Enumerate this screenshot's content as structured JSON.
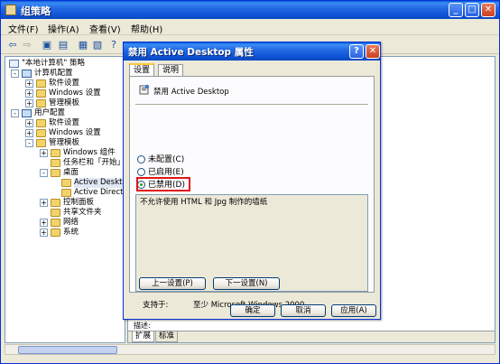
{
  "main_window": {
    "title": "组策略",
    "menu": [
      "文件(F)",
      "操作(A)",
      "查看(V)",
      "帮助(H)"
    ],
    "toolbar_icons": [
      "back-arrow-icon",
      "forward-arrow-icon",
      "up-folder-icon",
      "show-tree-icon",
      "properties-icon",
      "export-icon",
      "help-icon"
    ]
  },
  "tree": {
    "items": [
      {
        "label": "\"本地计算机\" 策略",
        "icon": "policy-icon"
      },
      {
        "label": "计算机配置",
        "icon": "computer-icon",
        "toggle": "-"
      },
      {
        "label": "软件设置",
        "icon": "folder-icon",
        "toggle": "+"
      },
      {
        "label": "Windows 设置",
        "icon": "folder-icon",
        "toggle": "+"
      },
      {
        "label": "管理模板",
        "icon": "folder-icon",
        "toggle": "+"
      },
      {
        "label": "用户配置",
        "icon": "user-icon",
        "toggle": "-"
      },
      {
        "label": "软件设置",
        "icon": "folder-icon",
        "toggle": "+"
      },
      {
        "label": "Windows 设置",
        "icon": "folder-icon",
        "toggle": "+"
      },
      {
        "label": "管理模板",
        "icon": "folder-icon",
        "toggle": "-"
      },
      {
        "label": "Windows 组件",
        "icon": "folder-icon",
        "toggle": "+"
      },
      {
        "label": "任务栏和「开始」菜",
        "icon": "folder-icon",
        "toggle": ""
      },
      {
        "label": "桌面",
        "icon": "folder-icon",
        "toggle": "-"
      },
      {
        "label": "Active Desktop",
        "icon": "folder-icon",
        "toggle": ""
      },
      {
        "label": "Active Directo",
        "icon": "folder-icon",
        "toggle": ""
      },
      {
        "label": "控制面板",
        "icon": "folder-icon",
        "toggle": "+"
      },
      {
        "label": "共享文件夹",
        "icon": "folder-icon",
        "toggle": ""
      },
      {
        "label": "网络",
        "icon": "folder-icon",
        "toggle": "+"
      },
      {
        "label": "系统",
        "icon": "folder-icon",
        "toggle": "+"
      }
    ]
  },
  "right_pane": {
    "fragment_text": "描述:",
    "tabs": [
      "扩展",
      "标准"
    ]
  },
  "dialog": {
    "title": "禁用 Active Desktop 属性",
    "tabs": [
      "设置",
      "说明"
    ],
    "setting_name": "禁用 Active Desktop",
    "radios": [
      {
        "label": "未配置(C)",
        "checked": false
      },
      {
        "label": "已启用(E)",
        "checked": false
      },
      {
        "label": "已禁用(D)",
        "checked": true
      }
    ],
    "description": "不允许使用 HTML 和 Jpg 制作的墙纸",
    "supported_label": "支持于:",
    "supported_value": "至少 Microsoft Windows 2000",
    "prev_button": "上一设置(P)",
    "next_button": "下一设置(N)",
    "ok_button": "确定",
    "cancel_button": "取消",
    "apply_button": "应用(A)"
  },
  "colors": {
    "titlebar": "#0c53d4",
    "highlight": "#e01515",
    "radio_dot": "#21a121"
  }
}
